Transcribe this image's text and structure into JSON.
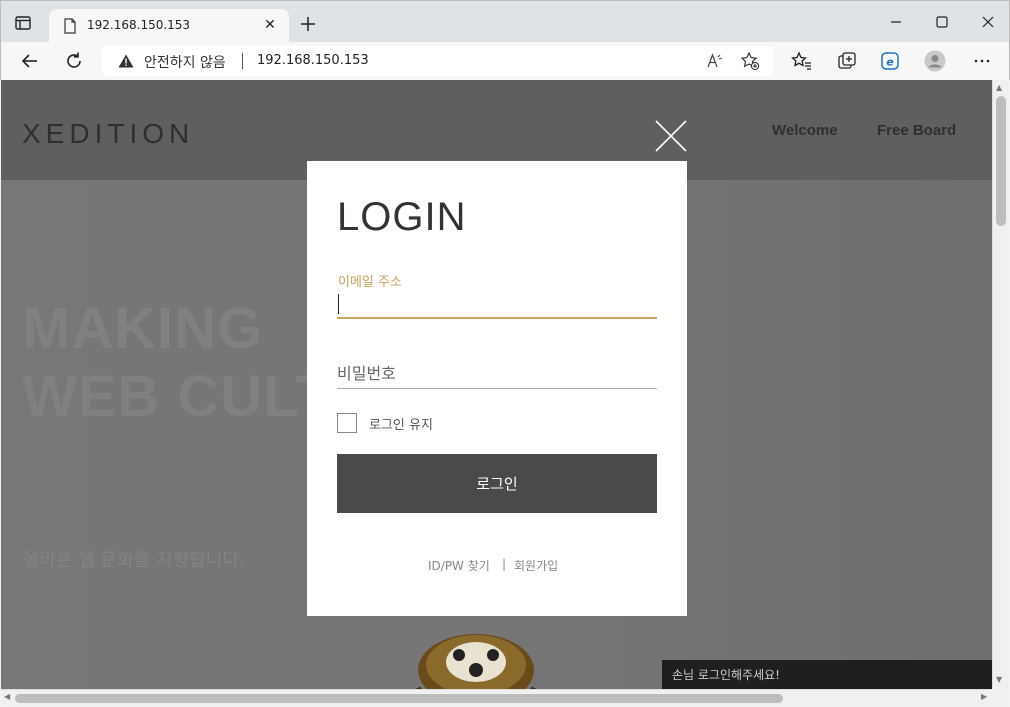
{
  "browser": {
    "tab_title": "192.168.150.153",
    "tab_close": "✕",
    "address": {
      "warning": "안전하지 않음",
      "url": "192.168.150.153"
    }
  },
  "site": {
    "logo": "XEDITION",
    "nav": [
      "Welcome",
      "Free Board"
    ],
    "hero": {
      "line1": "MAKING",
      "line2": "WEB CULT",
      "sub": "올바른 웹 문화를 지향합니다."
    }
  },
  "login": {
    "title": "LOGIN",
    "email_label": "이메일 주소",
    "email_value": "",
    "password_placeholder": "비밀번호",
    "remember_label": "로그인 유지",
    "submit_label": "로그인",
    "find_link": "ID/PW 찾기",
    "separator": "|",
    "join_link": "회원가입"
  },
  "guest_bar": {
    "text": "손님   로그인해주세요!"
  },
  "colors": {
    "accent": "#c7a457",
    "button": "#4a4a4a"
  }
}
